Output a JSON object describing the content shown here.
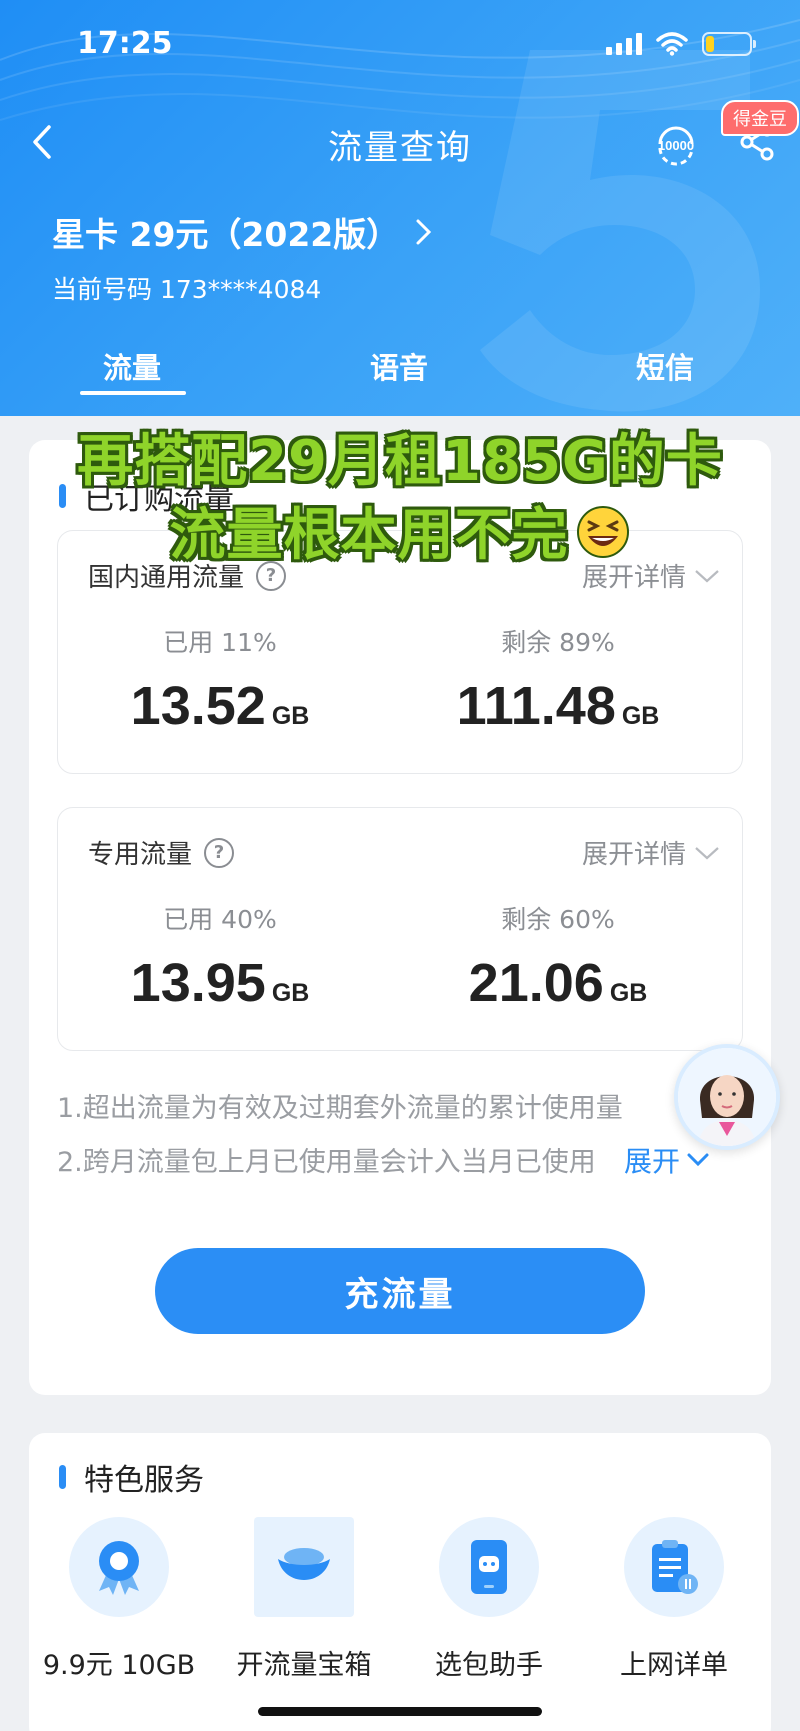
{
  "status_bar": {
    "time": "17:25",
    "battery_fill_fraction": 0.2
  },
  "nav": {
    "title": "流量查询",
    "service_icon_text": "10000",
    "badge": "得金豆"
  },
  "plan": {
    "name": "星卡 29元（2022版）",
    "phone": "当前号码 173****4084"
  },
  "tabs": [
    {
      "label": "流量",
      "active": true
    },
    {
      "label": "语音",
      "active": false
    },
    {
      "label": "短信",
      "active": false
    }
  ],
  "subscribed": {
    "title": "已订购流量",
    "boxes": [
      {
        "title": "国内通用流量",
        "expand": "展开详情",
        "used_label": "已用 11%",
        "used_value": "13.52",
        "remain_label": "剩余 89%",
        "remain_value": "111.48",
        "unit": "GB"
      },
      {
        "title": "专用流量",
        "expand": "展开详情",
        "used_label": "已用 40%",
        "used_value": "13.95",
        "remain_label": "剩余 60%",
        "remain_value": "21.06",
        "unit": "GB"
      }
    ],
    "notes": [
      "1.超出流量为有效及过期套外流量的累计使用量",
      "2.跨月流量包上月已使用量会计入当月已使用"
    ],
    "expand_more": "展开",
    "recharge": "充流量"
  },
  "services": {
    "title": "特色服务",
    "items": [
      {
        "label": "9.9元 10GB",
        "icon": "ribbon-award-icon"
      },
      {
        "label": "开流量宝箱",
        "icon": "treasure-bowl-icon"
      },
      {
        "label": "选包助手",
        "icon": "phone-robot-icon"
      },
      {
        "label": "上网详单",
        "icon": "clipboard-detail-icon"
      }
    ]
  },
  "overlay": {
    "line1": "再搭配29月租185G的卡",
    "line2": "流量根本用不完"
  },
  "colors": {
    "brand_blue": "#2b8ef5",
    "caption_green": "#8fd42a",
    "badge_red": "#fe6d6d"
  }
}
